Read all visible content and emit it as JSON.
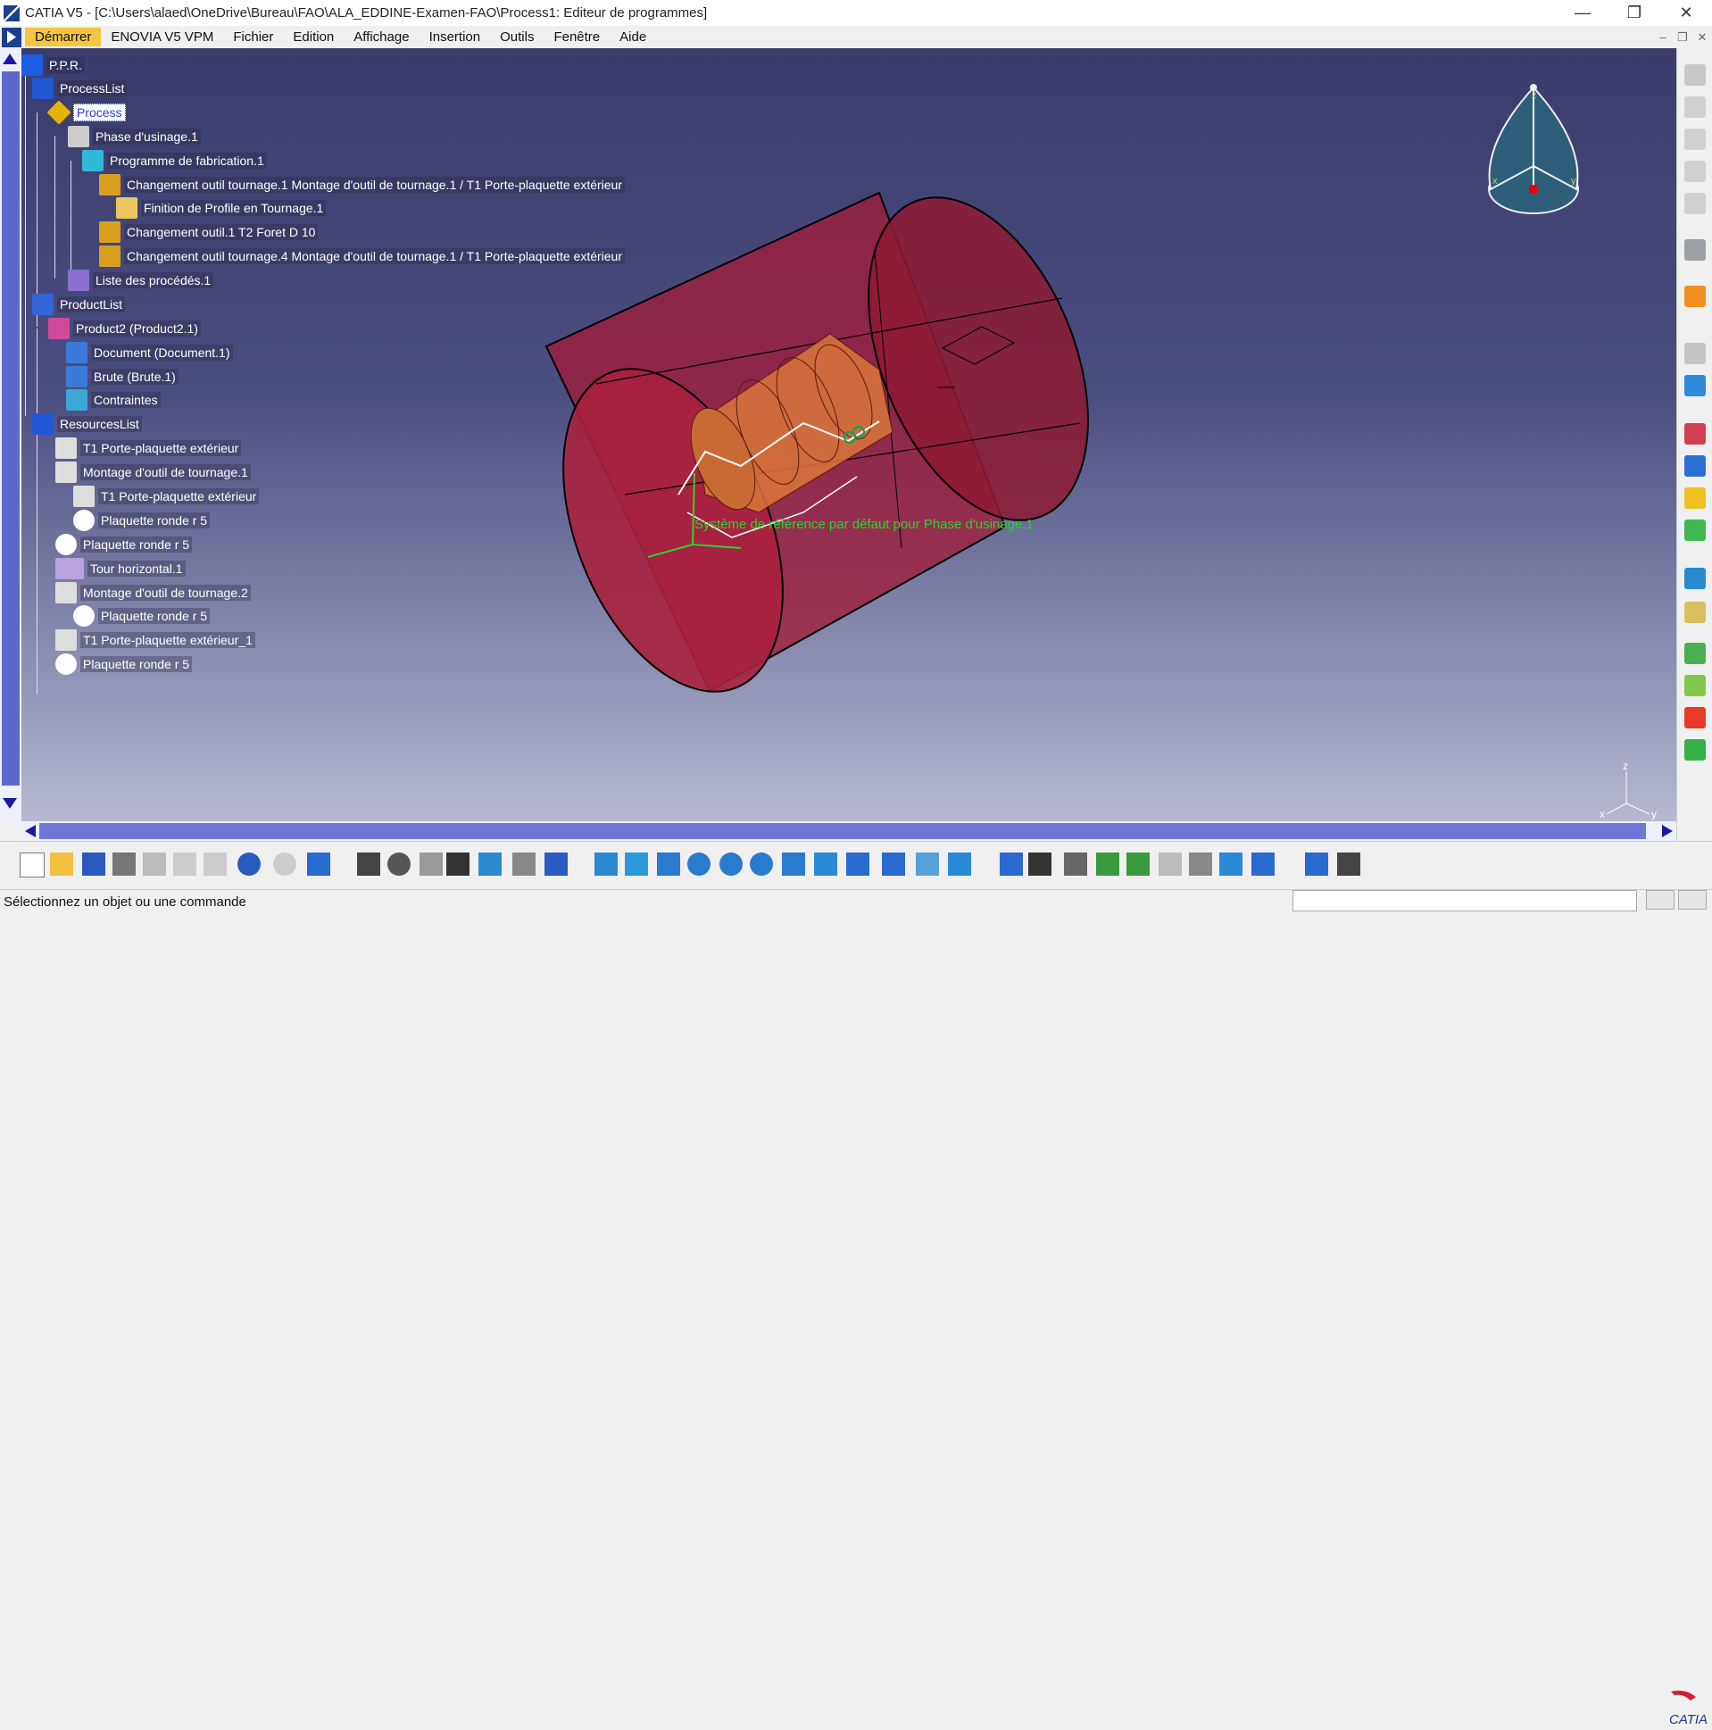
{
  "window": {
    "title": "CATIA V5 - [C:\\Users\\alaed\\OneDrive\\Bureau\\FAO\\ALA_EDDINE-Examen-FAO\\Process1: Editeur de programmes]",
    "minimize": "—",
    "maximize": "❐",
    "close": "✕"
  },
  "menu": {
    "items": [
      "Démarrer",
      "ENOVIA V5 VPM",
      "Fichier",
      "Edition",
      "Affichage",
      "Insertion",
      "Outils",
      "Fenêtre",
      "Aide"
    ],
    "active_index": 0
  },
  "doc_controls": [
    "–",
    "❐",
    "✕"
  ],
  "tree": {
    "root": "P.P.R.",
    "process_list": "ProcessList",
    "process": "Process",
    "phase": "Phase d'usinage.1",
    "program": "Programme de fabrication.1",
    "tool_change_1": "Changement outil tournage.1  Montage d'outil de tournage.1 / T1 Porte-plaquette extérieur",
    "finishing": "Finition de Profile en Tournage.1",
    "tool_change_2": "Changement outil.1  T2 Foret D 10",
    "tool_change_4": "Changement outil tournage.4  Montage d'outil de tournage.1 / T1 Porte-plaquette extérieur",
    "procedures": "Liste des procédés.1",
    "product_list": "ProductList",
    "product2": "Product2 (Product2.1)",
    "document": "Document (Document.1)",
    "brute": "Brute (Brute.1)",
    "constraints": "Contraintes",
    "resources_list": "ResourcesList",
    "res_1": "T1 Porte-plaquette extérieur",
    "res_2": "Montage d'outil de tournage.1",
    "res_3": "T1 Porte-plaquette extérieur",
    "res_4": "Plaquette ronde r 5",
    "res_5": "Plaquette ronde r 5",
    "res_6": "Tour horizontal.1",
    "res_7": "Montage d'outil de tournage.2",
    "res_8": "Plaquette ronde r 5",
    "res_9": "T1 Porte-plaquette extérieur_1",
    "res_10": "Plaquette ronde r 5"
  },
  "viewport": {
    "annotation": "Système de référence par défaut pour Phase d'usinage.1",
    "annotation_color": "#2fd12f",
    "stock_color": "#a01c3a",
    "part_color": "#d9773b",
    "compass_labels": {
      "z": "z",
      "x": "x",
      "y": "y"
    },
    "axis_labels": {
      "z": "z",
      "x": "x",
      "y": "y"
    }
  },
  "status": {
    "message": "Sélectionnez un objet ou une commande",
    "input_placeholder": ""
  },
  "brand": {
    "logo_text": "CATIA"
  }
}
